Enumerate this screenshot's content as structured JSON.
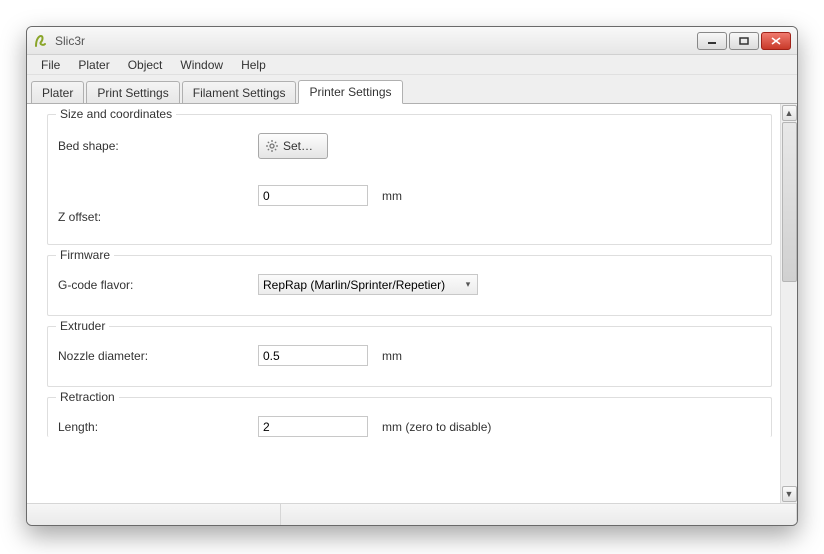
{
  "window": {
    "title": "Slic3r"
  },
  "menu": {
    "items": [
      "File",
      "Plater",
      "Object",
      "Window",
      "Help"
    ]
  },
  "tabs": {
    "items": [
      "Plater",
      "Print Settings",
      "Filament Settings",
      "Printer Settings"
    ],
    "active_index": 3
  },
  "groups": {
    "size": {
      "legend": "Size and coordinates",
      "bed_shape_label": "Bed shape:",
      "set_button": "Set…",
      "z_offset_label": "Z offset:",
      "z_offset_value": "0",
      "z_offset_unit": "mm"
    },
    "firmware": {
      "legend": "Firmware",
      "gcode_flavor_label": "G-code flavor:",
      "gcode_flavor_value": "RepRap (Marlin/Sprinter/Repetier)"
    },
    "extruder": {
      "legend": "Extruder",
      "nozzle_label": "Nozzle diameter:",
      "nozzle_value": "0.5",
      "nozzle_unit": "mm"
    },
    "retraction": {
      "legend": "Retraction",
      "length_label": "Length:",
      "length_value": "2",
      "length_unit": "mm (zero to disable)"
    }
  }
}
